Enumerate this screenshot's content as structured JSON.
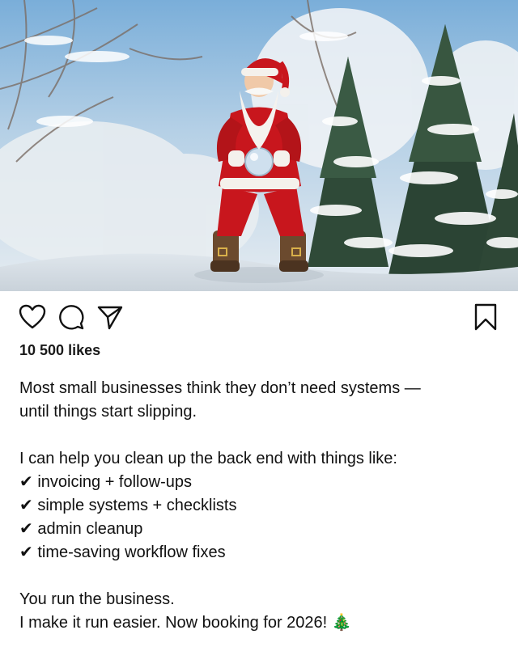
{
  "post": {
    "image_description_icons": [
      "santa",
      "snowy-forest"
    ],
    "likes_count": "10 500",
    "likes_label": "likes",
    "caption": {
      "para1": [
        "Most small businesses think they don’t need systems —",
        "until things start slipping."
      ],
      "para2": [
        "I can help you clean up the back end with things like:",
        "✔ invoicing + follow-ups",
        "✔ simple systems + checklists",
        "✔ admin cleanup",
        "✔ time-saving workflow fixes"
      ],
      "para3": [
        "You run the business.",
        "I make it run easier. Now booking for 2026! 🎄"
      ]
    }
  },
  "icons": {
    "like": "heart-icon",
    "comment": "speech-bubble-icon",
    "share": "paper-plane-icon",
    "save": "bookmark-icon"
  },
  "colors": {
    "santa_red": "#c8161d",
    "sky": "#8cb8e0",
    "snow": "#f2f5f8",
    "pine": "#2e4a37",
    "text": "#111111"
  }
}
